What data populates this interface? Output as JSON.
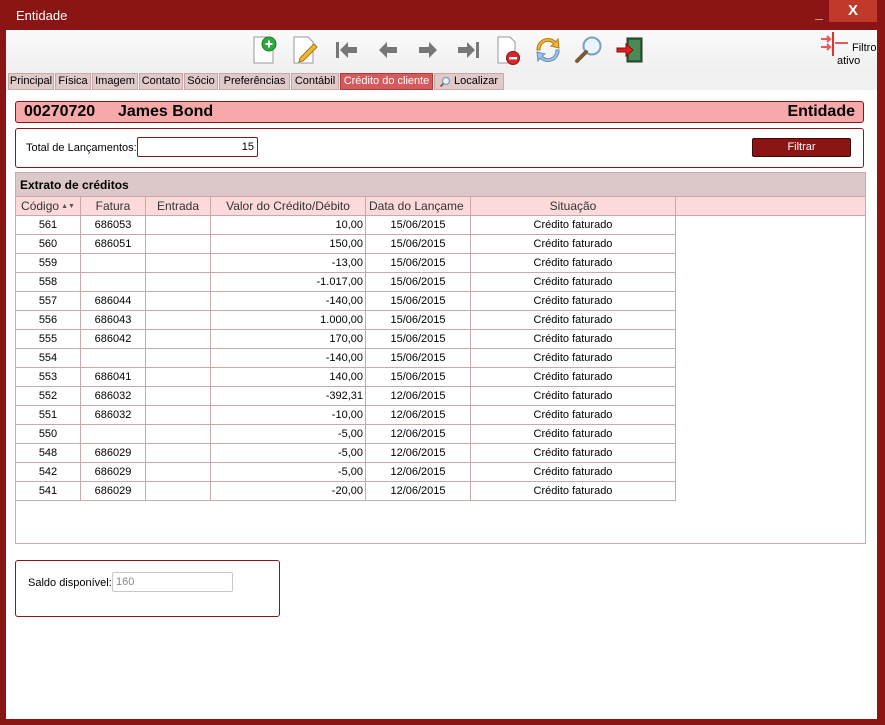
{
  "window": {
    "title": "Entidade",
    "minimize": "_",
    "close": "X"
  },
  "toolbar": {
    "buttons": [
      {
        "name": "new-icon"
      },
      {
        "name": "edit-icon"
      },
      {
        "name": "first-icon"
      },
      {
        "name": "prev-icon"
      },
      {
        "name": "next-icon"
      },
      {
        "name": "last-icon"
      },
      {
        "name": "delete-icon"
      },
      {
        "name": "refresh-icon"
      },
      {
        "name": "search-icon"
      },
      {
        "name": "exit-icon"
      }
    ],
    "filtro_line1": "Filtro",
    "filtro_line2": "ativo"
  },
  "tabs": [
    {
      "label": "Principal"
    },
    {
      "label": "Física"
    },
    {
      "label": "Imagem"
    },
    {
      "label": "Contato"
    },
    {
      "label": "Sócio"
    },
    {
      "label": "Preferências"
    },
    {
      "label": "Contábil"
    },
    {
      "label": "Crédito do cliente",
      "active": true
    },
    {
      "label": "Localizar"
    }
  ],
  "header": {
    "code": "00270720",
    "name": "James Bond",
    "entity": "Entidade"
  },
  "filter": {
    "total_label": "Total de Lançamentos:",
    "total_value": "15",
    "button": "Filtrar"
  },
  "grid": {
    "title": "Extrato de créditos",
    "columns": [
      "Código",
      "Fatura",
      "Entrada",
      "Valor do Crédito/Débito",
      "Data do Lançame",
      "Situação"
    ],
    "rows": [
      [
        "561",
        "686053",
        "",
        "10,00",
        "15/06/2015",
        "Crédito faturado"
      ],
      [
        "560",
        "686051",
        "",
        "150,00",
        "15/06/2015",
        "Crédito faturado"
      ],
      [
        "559",
        "",
        "",
        "-13,00",
        "15/06/2015",
        "Crédito faturado"
      ],
      [
        "558",
        "",
        "",
        "-1.017,00",
        "15/06/2015",
        "Crédito faturado"
      ],
      [
        "557",
        "686044",
        "",
        "-140,00",
        "15/06/2015",
        "Crédito faturado"
      ],
      [
        "556",
        "686043",
        "",
        "1.000,00",
        "15/06/2015",
        "Crédito faturado"
      ],
      [
        "555",
        "686042",
        "",
        "170,00",
        "15/06/2015",
        "Crédito faturado"
      ],
      [
        "554",
        "",
        "",
        "-140,00",
        "15/06/2015",
        "Crédito faturado"
      ],
      [
        "553",
        "686041",
        "",
        "140,00",
        "15/06/2015",
        "Crédito faturado"
      ],
      [
        "552",
        "686032",
        "",
        "-392,31",
        "12/06/2015",
        "Crédito faturado"
      ],
      [
        "551",
        "686032",
        "",
        "-10,00",
        "12/06/2015",
        "Crédito faturado"
      ],
      [
        "550",
        "",
        "",
        "-5,00",
        "12/06/2015",
        "Crédito faturado"
      ],
      [
        "548",
        "686029",
        "",
        "-5,00",
        "12/06/2015",
        "Crédito faturado"
      ],
      [
        "542",
        "686029",
        "",
        "-5,00",
        "12/06/2015",
        "Crédito faturado"
      ],
      [
        "541",
        "686029",
        "",
        "-20,00",
        "12/06/2015",
        "Crédito faturado"
      ]
    ]
  },
  "saldo": {
    "label": "Saldo disponível:",
    "value": "160"
  },
  "colors": {
    "brand": "#8b1414",
    "header_bg": "#f7a8a8",
    "active_tab": "#d35b5b"
  }
}
